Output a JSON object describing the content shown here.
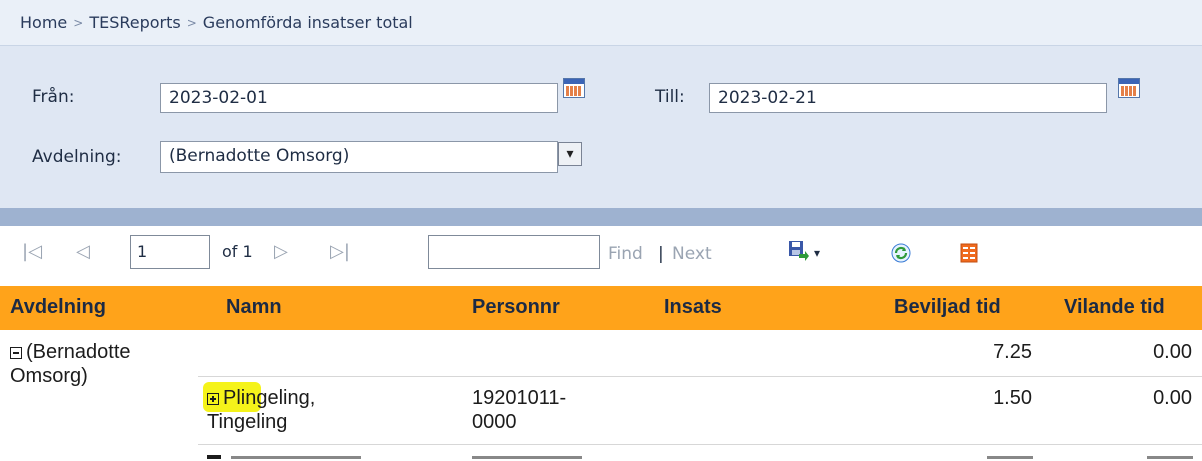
{
  "breadcrumb": {
    "home": "Home",
    "reports": "TESReports",
    "page": "Genomförda insatser total",
    "sep": ">"
  },
  "params": {
    "from_label": "Från:",
    "from_value": "2023-02-01",
    "to_label": "Till:",
    "to_value": "2023-02-21",
    "dept_label": "Avdelning:",
    "dept_value": "(Bernadotte Omsorg)"
  },
  "toolbar": {
    "first": "|◁",
    "prev": "◁",
    "page": "1",
    "of": "of 1",
    "next": "▷",
    "last": "▷|",
    "find": "Find",
    "divider": "|",
    "next_match": "Next",
    "export_caret": "▾"
  },
  "table": {
    "headers": [
      "Avdelning",
      "Namn",
      "Personnr",
      "Insats",
      "Beviljad tid",
      "Vilande tid"
    ],
    "group": {
      "name_line1": "(Bernadotte",
      "name_line2": "Omsorg)",
      "beviljad": "7.25",
      "vilande": "0.00"
    },
    "rows": [
      {
        "name_line1": "Plingeling,",
        "name_line2": "Tingeling",
        "personnr_line1": "19201011-",
        "personnr_line2": "0000",
        "beviljad": "1.50",
        "vilande": "0.00"
      }
    ]
  },
  "colors": {
    "header_bg": "#ffa31a",
    "params_bg": "#dfe7f3",
    "highlight": "#f4f20e"
  }
}
